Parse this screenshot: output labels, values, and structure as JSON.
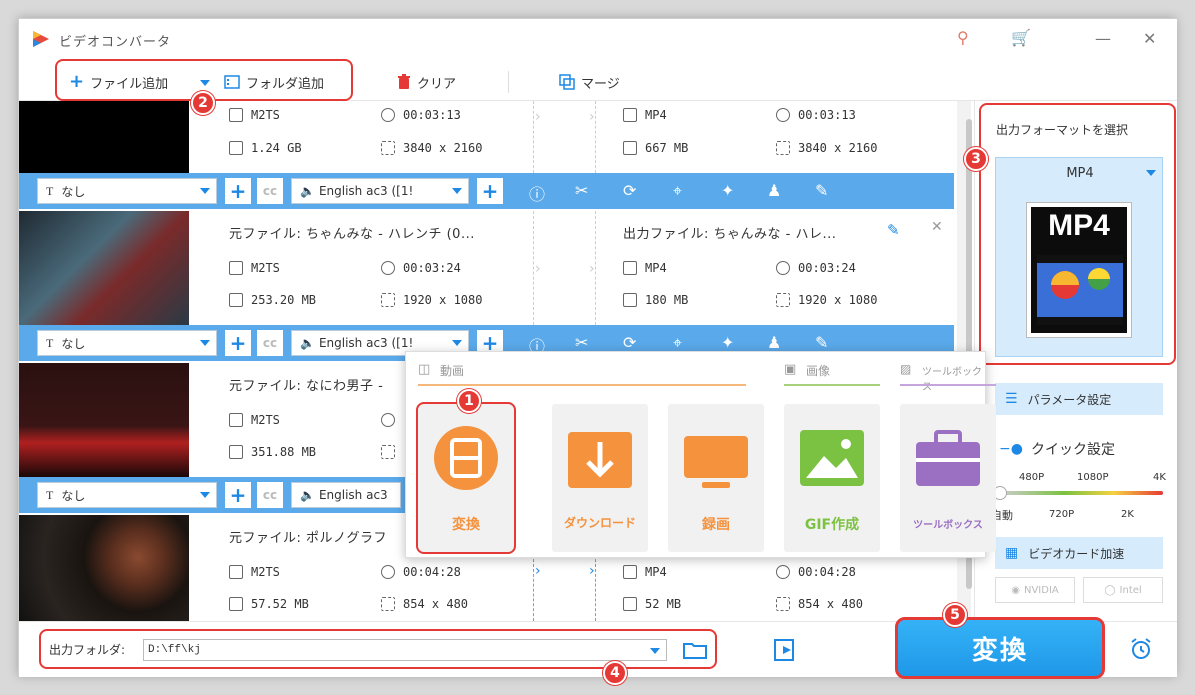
{
  "window": {
    "title": "ビデオコンバータ"
  },
  "toolbar": {
    "add_file": "ファイル追加",
    "add_folder": "フォルダ追加",
    "clear": "クリア",
    "merge": "マージ"
  },
  "files": [
    {
      "input_name": "",
      "output_name": "",
      "input_format": "M2TS",
      "input_duration": "00:03:13",
      "input_size": "1.24 GB",
      "input_resolution": "3840 x 2160",
      "output_format": "MP4",
      "output_duration": "00:03:13",
      "output_size": "667 MB",
      "output_resolution": "3840 x 2160"
    },
    {
      "input_name": "元ファイル: ちゃんみな - ハレンチ (0...",
      "output_name": "出力ファイル: ちゃんみな - ハレ...",
      "input_format": "M2TS",
      "input_duration": "00:03:24",
      "input_size": "253.20 MB",
      "input_resolution": "1920 x 1080",
      "output_format": "MP4",
      "output_duration": "00:03:24",
      "output_size": "180 MB",
      "output_resolution": "1920 x 1080"
    },
    {
      "input_name": "元ファイル: なにわ男子 -",
      "output_name": "",
      "input_format": "M2TS",
      "input_duration": "",
      "input_size": "351.88 MB",
      "input_resolution": "",
      "output_format": "",
      "output_duration": "",
      "output_size": "",
      "output_resolution": ""
    },
    {
      "input_name": "元ファイル: ポルノグラフ",
      "output_name": "",
      "input_format": "M2TS",
      "input_duration": "00:04:28",
      "input_size": "57.52 MB",
      "input_resolution": "854 x 480",
      "output_format": "MP4",
      "output_duration": "00:04:28",
      "output_size": "52 MB",
      "output_resolution": "854 x 480"
    }
  ],
  "strip": {
    "subtitle": "なし",
    "audio": "English ac3 ([1!",
    "audio_short": "English ac3"
  },
  "popup": {
    "section_video": "動画",
    "section_image": "画像",
    "section_toolbox": "ツールボックス",
    "tiles": [
      "変換",
      "ダウンロード",
      "録画",
      "GIF作成",
      "ツールボックス"
    ]
  },
  "right_panel": {
    "select_format": "出力フォーマットを選択",
    "format": "MP4",
    "format_icon_text": "MP4",
    "param_settings": "パラメータ設定",
    "quick_settings": "クイック設定",
    "quality_top": [
      "480P",
      "1080P",
      "4K"
    ],
    "quality_bottom": [
      "自動",
      "720P",
      "2K"
    ],
    "gpu_accel": "ビデオカード加速",
    "nvidia": "NVIDIA",
    "intel": "Intel"
  },
  "bottom": {
    "output_folder_label": "出力フォルダ:",
    "output_folder_value": "D:\\ff\\kj",
    "convert": "変換"
  },
  "badges": [
    "1",
    "2",
    "3",
    "4",
    "5"
  ],
  "colors": {
    "accent_blue": "#1e88e5",
    "strip_blue": "#5aa9ea",
    "highlight_red": "#e53935",
    "tile_orange": "#f5923e",
    "tile_green": "#7cc242",
    "tile_purple": "#9b6fc2",
    "convert_button": "#2ea8f4"
  }
}
